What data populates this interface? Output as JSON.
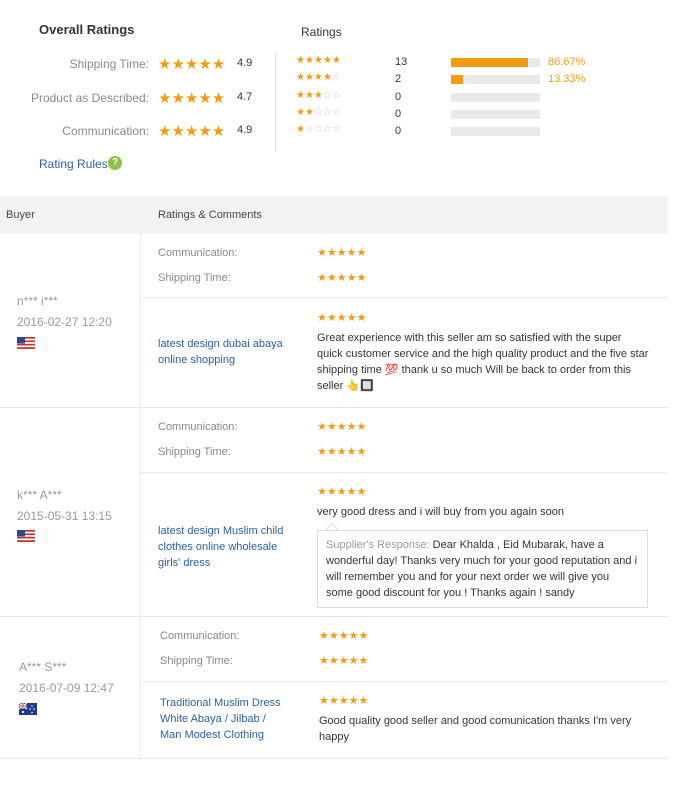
{
  "summary": {
    "title": "Overall Ratings",
    "rows": [
      {
        "label": "Shipping Time:",
        "score": "4.9"
      },
      {
        "label": "Product as Described:",
        "score": "4.7"
      },
      {
        "label": "Communication:",
        "score": "4.9"
      }
    ],
    "rules_label": "Rating Rules",
    "rules_icon": "?"
  },
  "histogram": {
    "title": "Ratings",
    "rows": [
      {
        "stars": 5,
        "count": "13",
        "fraction": 0.8667,
        "percent": "86.67%"
      },
      {
        "stars": 4,
        "count": "2",
        "fraction": 0.1333,
        "percent": "13.33%"
      },
      {
        "stars": 3,
        "count": "0",
        "fraction": 0,
        "percent": ""
      },
      {
        "stars": 2,
        "count": "0",
        "fraction": 0,
        "percent": ""
      },
      {
        "stars": 1,
        "count": "0",
        "fraction": 0,
        "percent": ""
      }
    ]
  },
  "table": {
    "buyer_header": "Buyer",
    "ratings_header": "Ratings & Comments"
  },
  "reviews": [
    {
      "buyer": "n*** i***",
      "date": "2016-02-27 12:20",
      "flag": "us",
      "communication_label": "Communication:",
      "shipping_label": "Shipping Time:",
      "communication_stars": 5,
      "shipping_stars": 5,
      "product_stars": 5,
      "product": "latest design dubai abaya online shopping",
      "comment": "Great experience with this seller am so satisfied with the super quick customer service and the high quality product and the five star shipping time 💯 thank u so much Will be back to order from this seller 👆🔲"
    },
    {
      "buyer": "k*** A***",
      "date": "2015-05-31 13:15",
      "flag": "us",
      "communication_label": "Communication:",
      "shipping_label": "Shipping Time:",
      "communication_stars": 5,
      "shipping_stars": 5,
      "product_stars": 5,
      "product": "latest design Muslim child clothes online wholesale girls' dress",
      "comment": "very good dress and i will buy from you again soon",
      "response_label": "Supplier's Response:",
      "response": "Dear Khalda , Eid Mubarak, have a wonderful day! Thanks very much for your good reputation and i will remember you and for your next order we will give you some good discount for you ! Thanks again ! sandy"
    },
    {
      "buyer": "A*** S***",
      "date": "2016-07-09 12:47",
      "flag": "au",
      "communication_label": "Communication:",
      "shipping_label": "Shipping Time:",
      "communication_stars": 5,
      "shipping_stars": 5,
      "product_stars": 5,
      "product": "Traditional Muslim Dress White Abaya / Jilbab / Man Modest Clothing",
      "comment": "Good quality good seller and good comunication thanks I'm very happy"
    }
  ],
  "colors": {
    "accent": "#f39c12",
    "link": "#2b5fa8",
    "rules_icon": "#8bc34a"
  }
}
